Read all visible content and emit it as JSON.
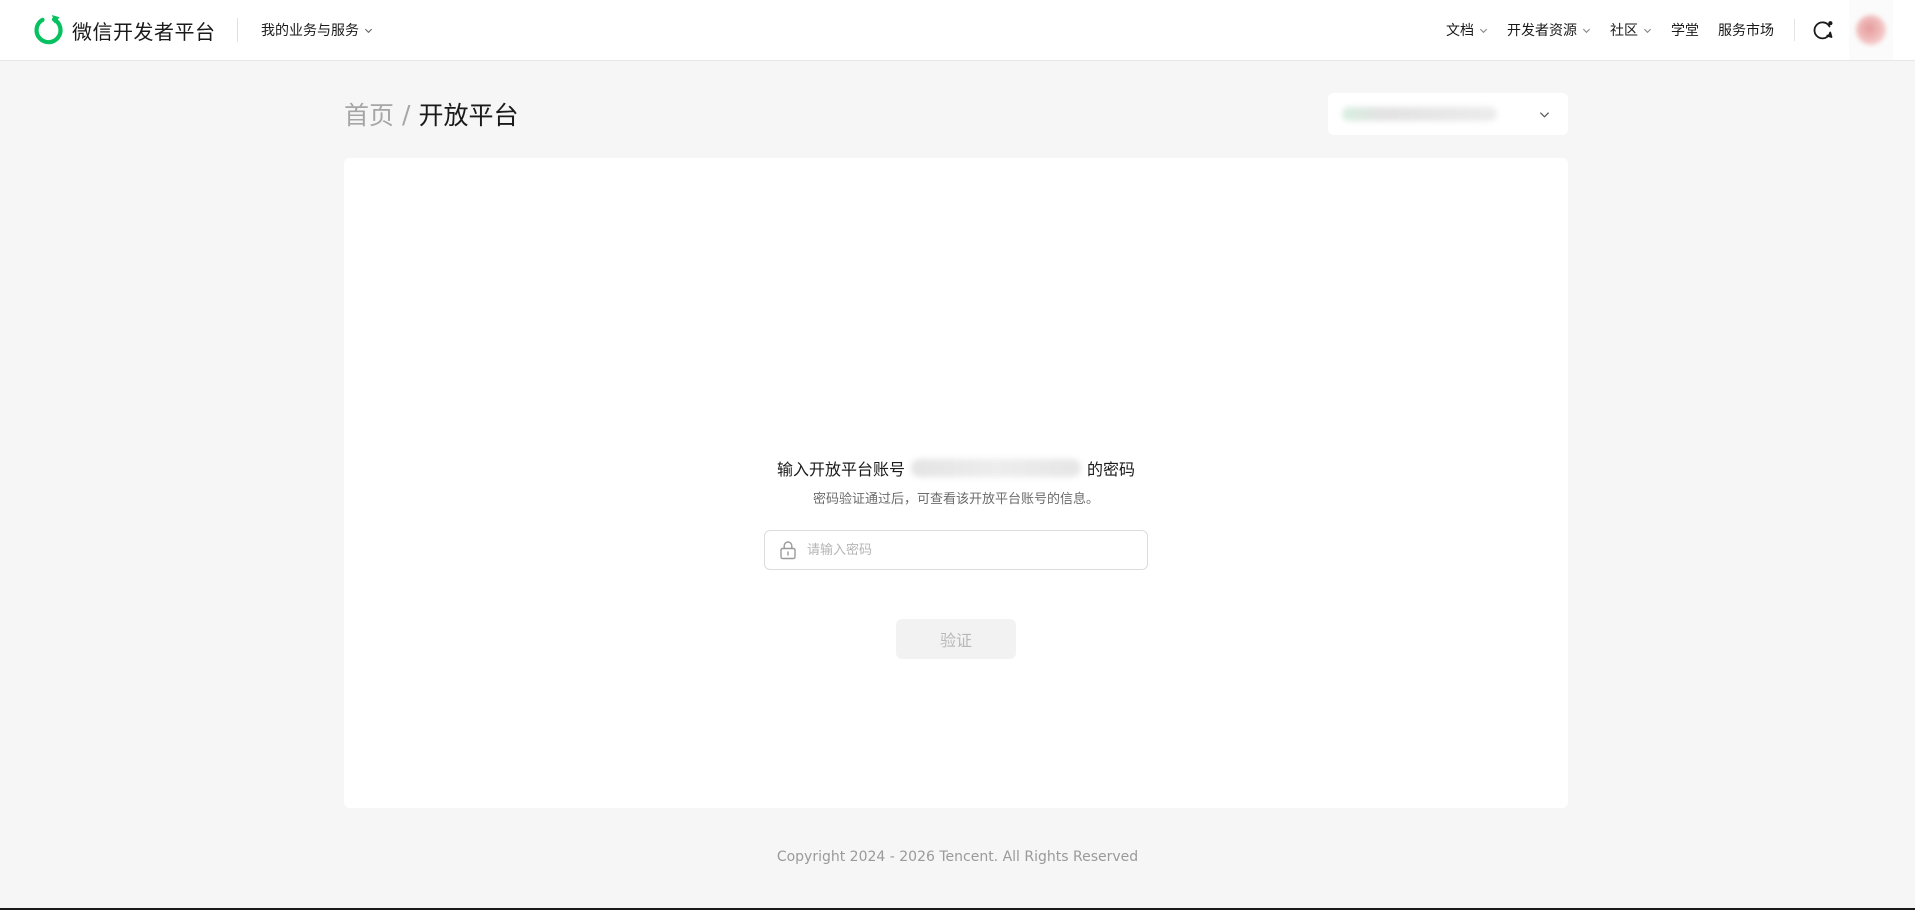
{
  "header": {
    "brand_name": "微信开发者平台",
    "business_menu": "我的业务与服务",
    "nav": {
      "docs": "文档",
      "dev_resources": "开发者资源",
      "community": "社区",
      "academy": "学堂",
      "market": "服务市场"
    }
  },
  "breadcrumb": {
    "home": "首页",
    "separator": "/",
    "current": "开放平台"
  },
  "verify": {
    "title_prefix": "输入开放平台账号",
    "title_suffix": "的密码",
    "subtitle": "密码验证通过后，可查看该开放平台账号的信息。",
    "password_placeholder": "请输入密码",
    "password_value": "",
    "button_label": "验证"
  },
  "footer": {
    "copyright": "Copyright 2024 - 2026 Tencent. All Rights Reserved"
  },
  "colors": {
    "brand_green": "#07c160",
    "page_bg": "#f6f6f6",
    "card_bg": "#ffffff",
    "disabled_button_bg": "#f2f2f2"
  },
  "icons": {
    "brand": "wechat-dev-logo-icon",
    "chevron": "chevron-down-icon",
    "feedback": "feedback-icon",
    "lock": "lock-icon"
  }
}
